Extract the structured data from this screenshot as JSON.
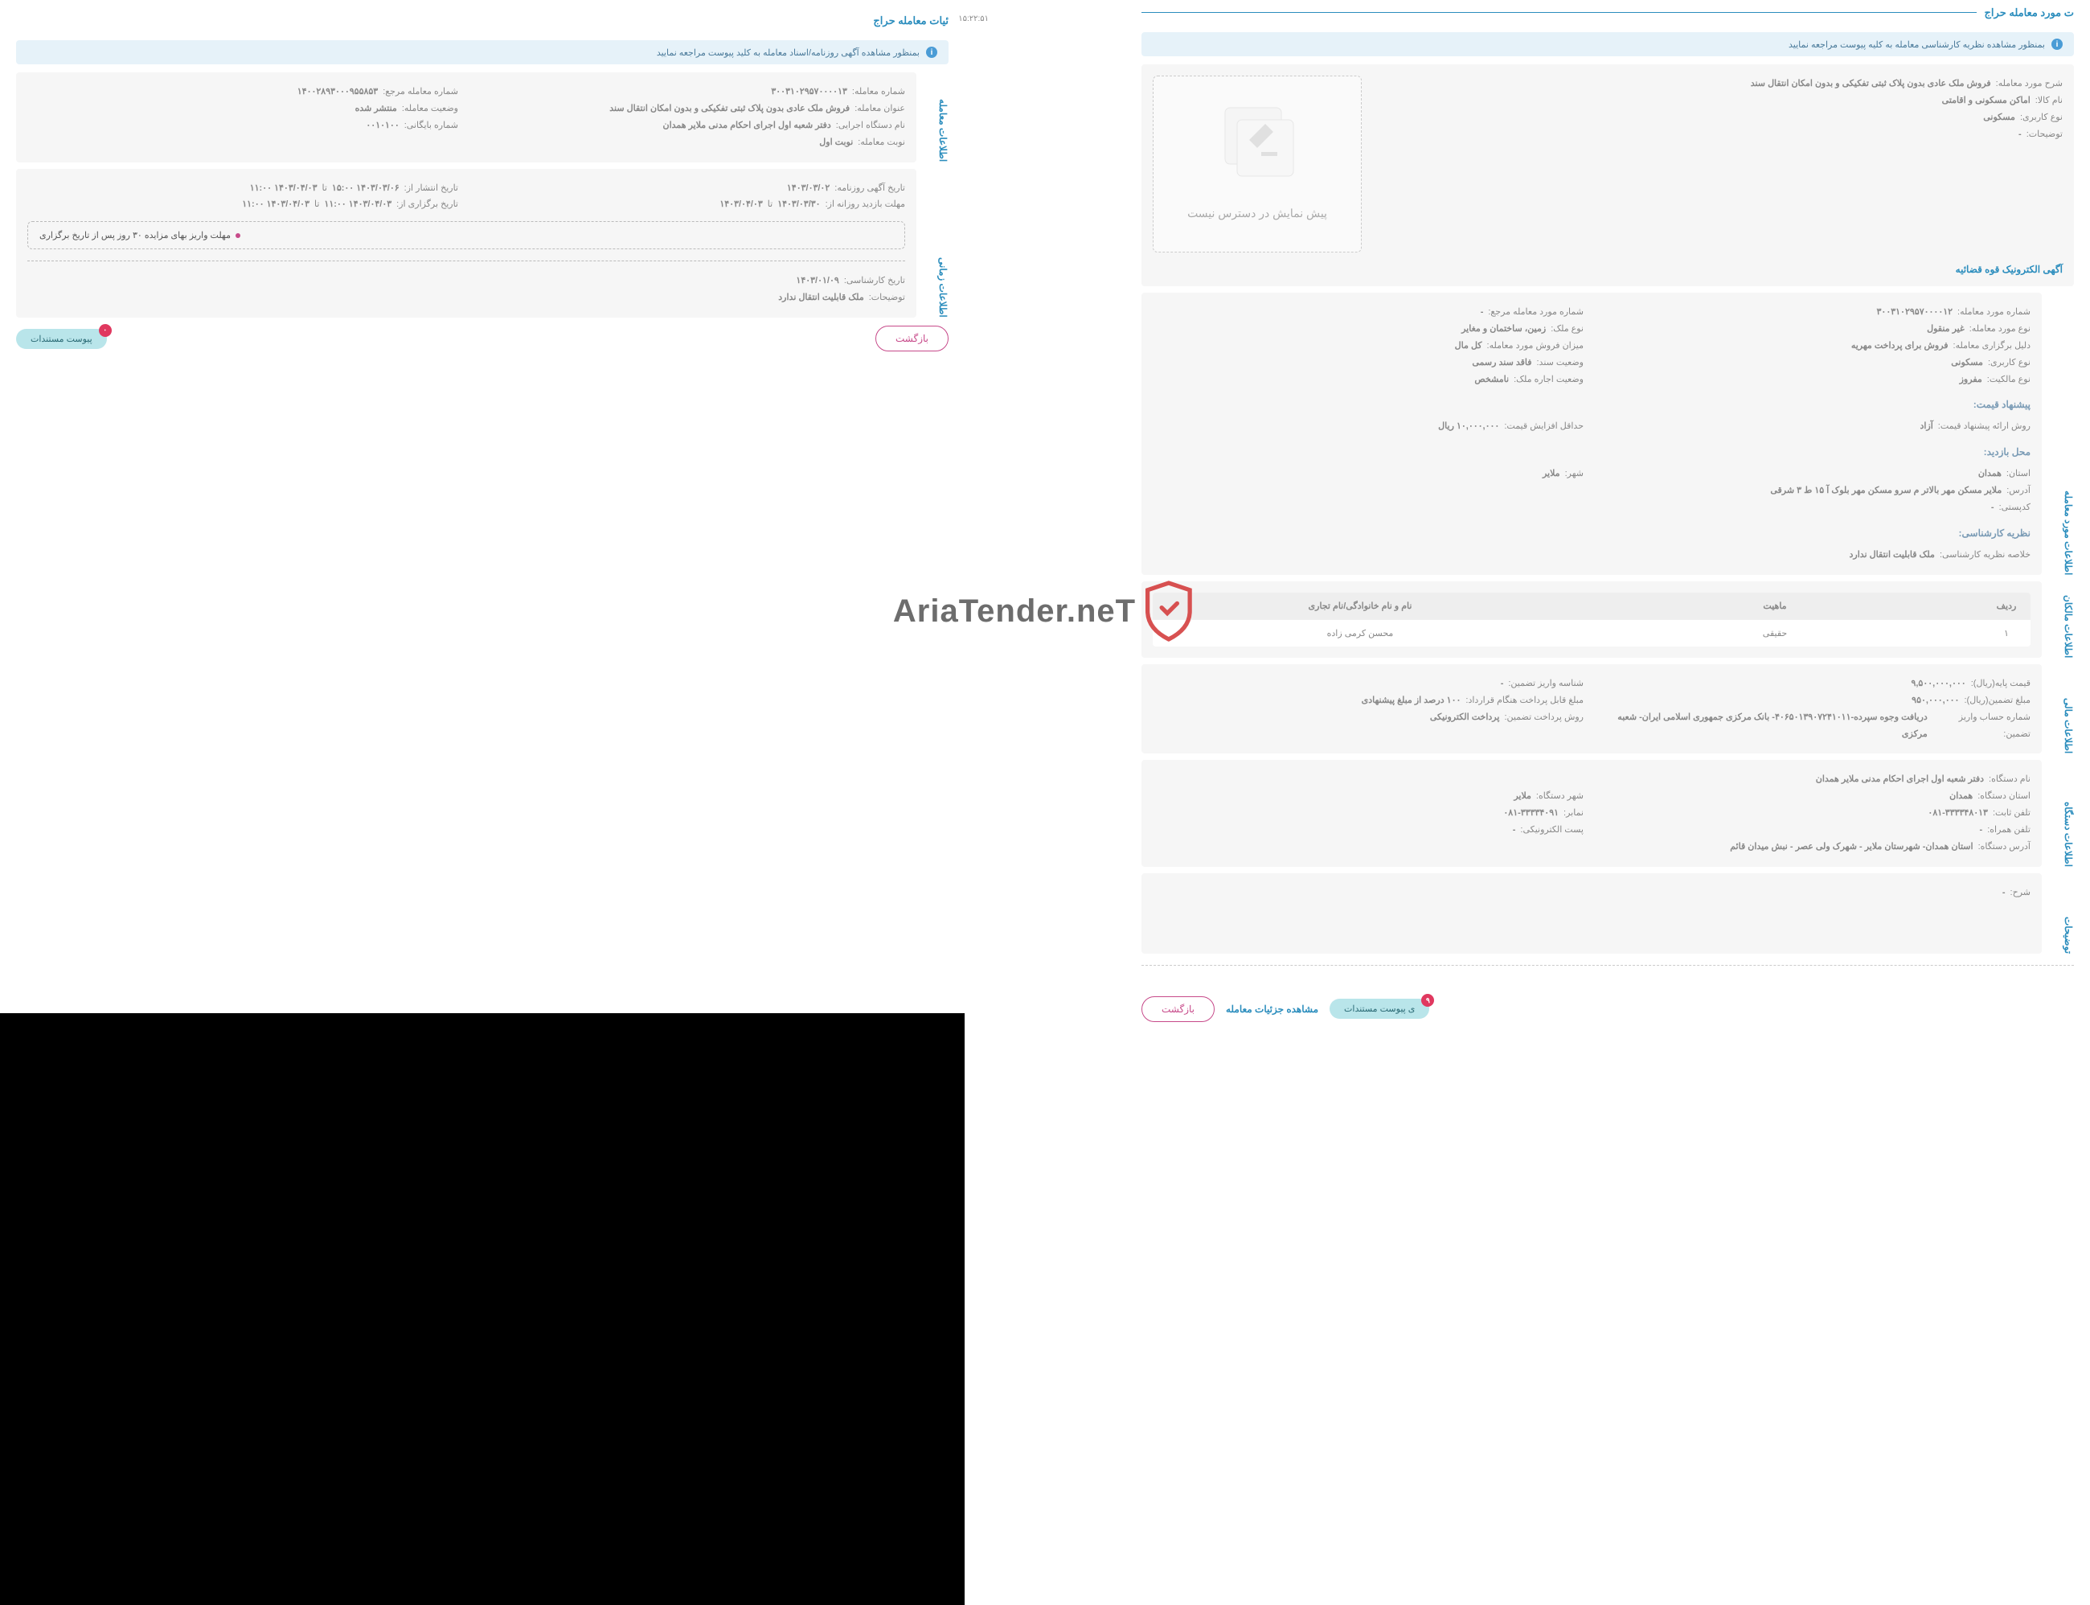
{
  "timestamp": "۱۵:۲۲:۵۱",
  "watermark": "AriaTender.neT",
  "right": {
    "section_title": "ت مورد معامله حراج",
    "info_bar": "بمنظور مشاهده نظریه کارشناسی معامله به کلیه پیوست مراجعه نمایید",
    "preview_na": "پیش نمایش در دسترس نیست",
    "link_agahi": "آگهی الکترونیک قوه قضائیه",
    "transaction_info_tab": "اطلاعات مورد معامله",
    "owners_tab": "اطلاعات مالکان",
    "financial_tab": "اطلاعات مالی",
    "agency_tab": "اطلاعات دستگاه",
    "notes_tab": "توضیحات",
    "fields": {
      "sharh_label": "شرح مورد معامله:",
      "sharh_value": "فروش ملک عادی بدون پلاک ثبتی تفکیکی و بدون امکان انتقال سند",
      "kala_label": "نام کالا:",
      "kala_value": "اماکن مسکونی و اقامتی",
      "karbari_label": "نوع کاربری:",
      "karbari_value": "مسکونی",
      "tozihat_label": "توضیحات:",
      "tozihat_value": "-",
      "shomare_label": "شماره مورد معامله:",
      "shomare_value": "۳۰۰۳۱۰۲۹۵۷۰۰۰۰۱۲",
      "no_moamele_label": "نوع مورد معامله:",
      "no_moamele_value": "غیر منقول",
      "dalil_label": "دلیل برگزاری معامله:",
      "dalil_value": "فروش برای پرداخت مهریه",
      "karbari2_value": "مسکونی",
      "malekiat_label": "نوع مالکیت:",
      "malekiat_value": "مفروز",
      "shomare_marja_label": "شماره مورد معامله مرجع:",
      "shomare_marja_value": "-",
      "no_melk_label": "نوع ملک:",
      "no_melk_value": "زمین، ساختمان و مغایر",
      "mizan_label": "میزان فروش مورد معامله:",
      "mizan_value": "کل مال",
      "vaziat_sanad_label": "وضعیت سند:",
      "vaziat_sanad_value": "فاقد سند رسمی",
      "vaziat_ejare_label": "وضعیت اجاره ملک:",
      "vaziat_ejare_value": "نامشخص"
    },
    "price_section": "پیشنهاد قیمت:",
    "price_method_label": "روش ارائه پیشنهاد قیمت:",
    "price_method_value": "آزاد",
    "min_increase_label": "حداقل افزایش قیمت:",
    "min_increase_value": "۱۰,۰۰۰,۰۰۰ ریال",
    "visit_section": "محل بازدید:",
    "province_label": "استان:",
    "province_value": "همدان",
    "city_label": "شهر:",
    "city_value": "ملایر",
    "address_label": "آدرس:",
    "address_value": "ملایر مسکن مهر بالاتر م سرو مسکن مهر بلوک آ ۱۵ ط ۳ شرقی",
    "postal_label": "کدپستی:",
    "postal_value": "-",
    "expert_section": "نظریه کارشناسی:",
    "expert_summary_label": "خلاصه نظریه کارشناسی:",
    "expert_summary_value": "ملک قابلیت انتقال ندارد",
    "owners_table": {
      "headers": {
        "row": "ردیف",
        "type": "ماهیت",
        "name": "نام و نام خانوادگی/نام تجاری"
      },
      "rows": [
        {
          "row": "۱",
          "type": "حقیقی",
          "name": "محسن کرمی زاده"
        }
      ]
    },
    "financial": {
      "base_price_label": "قیمت پایه(ریال):",
      "base_price_value": "۹,۵۰۰,۰۰۰,۰۰۰",
      "deposit_label": "مبلغ تضمین(ریال):",
      "deposit_value": "۹۵۰,۰۰۰,۰۰۰",
      "account_label": "شماره حساب واریز تضمین:",
      "account_value": "دریافت وجوه سپرده-۴۰۶۵۰۱۳۹۰۷۲۴۱۰۱۱- بانک مرکزی جمهوری اسلامی ایران- شعبه مرکزی",
      "deposit_id_label": "شناسه واریز تضمین:",
      "deposit_id_value": "-",
      "payable_label": "مبلغ قابل پرداخت هنگام قرارداد:",
      "payable_value": "۱۰۰ درصد از مبلغ پیشنهادی",
      "pay_method_label": "روش پرداخت تضمین:",
      "pay_method_value": "پرداخت الکترونیکی"
    },
    "agency": {
      "name_label": "نام دستگاه:",
      "name_value": "دفتر شعبه اول اجرای احکام مدنی ملایر همدان",
      "province_label": "استان دستگاه:",
      "province_value": "همدان",
      "city_label": "شهر دستگاه:",
      "city_value": "ملایر",
      "phone_label": "تلفن ثابت:",
      "phone_value": "۰۸۱-۳۳۳۳۴۸۰۱۳",
      "fax_label": "نمابر:",
      "fax_value": "۰۸۱-۳۳۳۳۴۰۹۱",
      "mobile_label": "تلفن همراه:",
      "mobile_value": "-",
      "email_label": "پست الکترونیکی:",
      "email_value": "-",
      "address_label": "آدرس دستگاه:",
      "address_value": "استان همدان- شهرستان ملایر - شهرک ولی عصر - نبش میدان قائم"
    },
    "desc_label": "شرح:",
    "desc_value": "-",
    "back_btn": "بازگشت",
    "details_link": "مشاهده جزئیات معامله",
    "attach_btn": "ی پیوست مستندات",
    "attach_count": "۹"
  },
  "left": {
    "section_title": "ئیات معامله حراج",
    "info_bar": "بمنظور مشاهده آگهی روزنامه/اسناد معامله به کلید پیوست مراجعه نمایید",
    "tab1": "اطلاعات معامله",
    "tab2": "اطلاعات زمانی",
    "fields": {
      "shomare_label": "شماره معامله:",
      "shomare_value": "۳۰۰۳۱۰۲۹۵۷۰۰۰۰۱۳",
      "onvan_label": "عنوان معامله:",
      "onvan_value": "فروش ملک عادی بدون پلاک ثبتی تفکیکی و بدون امکان انتقال سند",
      "dastgah_label": "نام دستگاه اجرایی:",
      "dastgah_value": "دفتر شعبه اول اجرای احکام مدنی ملایر همدان",
      "nobat_label": "نوبت معامله:",
      "nobat_value": "نوبت اول",
      "marja_label": "شماره معامله مرجع:",
      "marja_value": "۱۴۰۰۲۸۹۳۰۰۰۹۵۵۸۵۳",
      "vaziat_label": "وضعیت معامله:",
      "vaziat_value": "منتشر شده",
      "baygani_label": "شماره بایگانی:",
      "baygani_value": "۰۰۱۰۱۰۰"
    },
    "time_fields": {
      "tarikh_agahi_label": "تاریخ آگهی روزنامه:",
      "tarikh_agahi_value": "۱۴۰۳/۰۳/۰۲",
      "mohlat_label": "مهلت بازدید روزانه از:",
      "mohlat_from": "۱۴۰۳/۰۳/۳۰",
      "mohlat_to": "۱۴۰۳/۰۴/۰۳",
      "ta": "تا",
      "enteshar_label": "تاریخ انتشار از:",
      "enteshar_from": "۱۴۰۳/۰۳/۰۶ ۱۵:۰۰",
      "enteshar_to": "۱۴۰۳/۰۴/۰۳ ۱۱:۰۰",
      "bargozari_label": "تاریخ برگزاری از:",
      "bargozari_from": "۱۴۰۳/۰۴/۰۳ ۱۱:۰۰",
      "bargozari_to": "۱۴۰۳/۰۴/۰۳ ۱۱:۰۰",
      "variz_note": "مهلت واریز بهای مزایده ۳۰ روز پس از تاریخ برگزاری",
      "karshenasi_label": "تاریخ کارشناسی:",
      "karshenasi_value": "۱۴۰۳/۰۱/۰۹",
      "tozihat_label": "توضیحات:",
      "tozihat_value": "ملک قابلیت انتقال ندارد"
    },
    "back_btn": "بازگشت",
    "attach_btn": "پیوست مستندات",
    "attach_count": "۰"
  }
}
